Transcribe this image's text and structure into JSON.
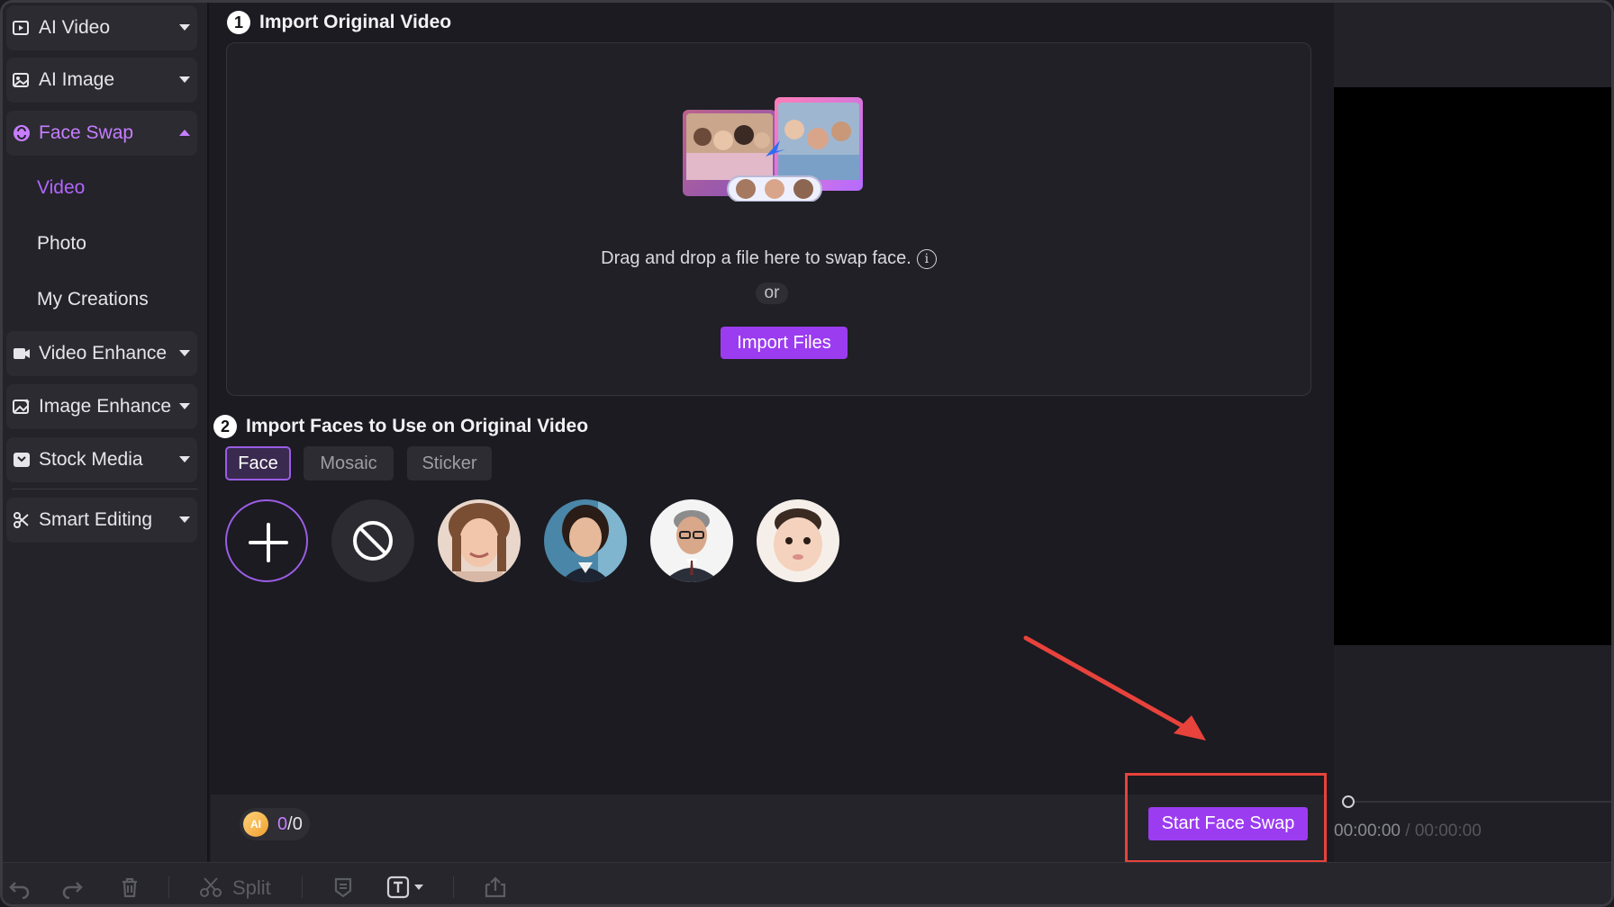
{
  "sidebar": {
    "items": [
      {
        "label": "AI Video",
        "icon": "ai-video-icon"
      },
      {
        "label": "AI Image",
        "icon": "ai-image-icon"
      },
      {
        "label": "Face Swap",
        "icon": "face-swap-icon",
        "expanded": true
      },
      {
        "label": "Video Enhance",
        "icon": "video-enhance-icon"
      },
      {
        "label": "Image Enhance",
        "icon": "image-enhance-icon"
      },
      {
        "label": "Stock Media",
        "icon": "stock-media-icon"
      },
      {
        "label": "Smart Editing",
        "icon": "smart-editing-icon"
      }
    ],
    "face_swap_sub": [
      {
        "label": "Video",
        "active": true
      },
      {
        "label": "Photo"
      },
      {
        "label": "My Creations"
      }
    ]
  },
  "step1": {
    "number": "1",
    "title": "Import Original Video",
    "drop_text": "Drag and drop a file here to swap face.",
    "info_glyph": "i",
    "or_label": "or",
    "import_button": "Import Files"
  },
  "step2": {
    "number": "2",
    "title": "Import Faces to Use on Original Video",
    "tabs": [
      {
        "label": "Face",
        "active": true
      },
      {
        "label": "Mosaic"
      },
      {
        "label": "Sticker"
      }
    ]
  },
  "credits": {
    "coin_label": "AI",
    "used": "0",
    "separator": "/",
    "total": "0"
  },
  "start_button": "Start Face Swap",
  "preview": {
    "current_time": "00:00:00",
    "separator": " / ",
    "total_time": "00:00:00"
  },
  "toolbar": {
    "split_label": "Split"
  },
  "colors": {
    "accent": "#9b3cf0",
    "accent_text": "#c77dff",
    "highlight": "#e8423c",
    "background": "#1b1b21"
  }
}
